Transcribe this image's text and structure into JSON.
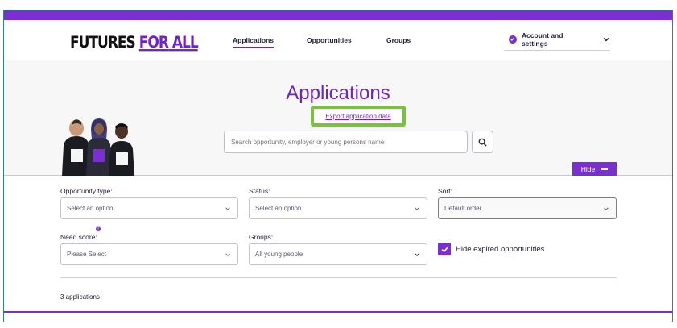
{
  "brand": {
    "logo_part1": "FUTURES",
    "logo_part2": "FOR ALL",
    "accent": "#7a2fd0",
    "highlight": "#7ac143"
  },
  "nav": {
    "items": [
      {
        "label": "Applications",
        "active": true
      },
      {
        "label": "Opportunities",
        "active": false
      },
      {
        "label": "Groups",
        "active": false
      }
    ],
    "account_label": "Account and settings"
  },
  "hero": {
    "title": "Applications",
    "export_link": "Export application data",
    "search_placeholder": "Search opportunity, employer or young persons name",
    "hide_button": "Hide",
    "image_icon": "people-photo"
  },
  "filters": {
    "opportunity_type": {
      "label": "Opportunity type:",
      "value": "Select an option"
    },
    "status": {
      "label": "Status:",
      "value": "Select an option"
    },
    "sort": {
      "label": "Sort:",
      "value": "Default order"
    },
    "need_score": {
      "label": "Need score:",
      "value": "Please Select",
      "help": "?"
    },
    "groups": {
      "label": "Groups:",
      "value": "All young people"
    },
    "hide_expired": {
      "label": "Hide expired opportunities",
      "checked": true
    }
  },
  "results": {
    "count_text": "3 applications"
  }
}
